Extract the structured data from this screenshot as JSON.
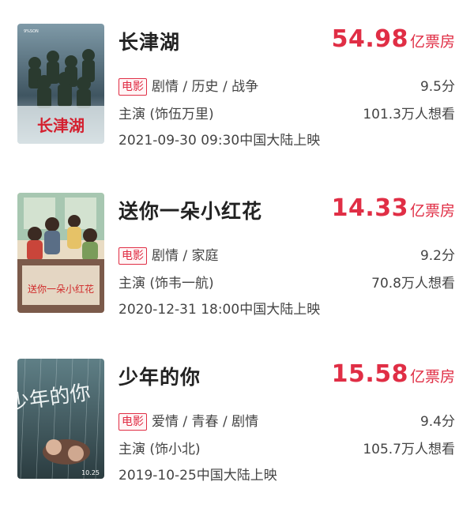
{
  "movies": [
    {
      "title": "长津湖",
      "box_office_amount": "54.98",
      "box_office_unit": "亿票房",
      "tag": "电影",
      "genres": "剧情 / 历史 / 战争",
      "score": "9.5分",
      "cast": "主演 (饰伍万里)",
      "want_to_see": "101.3万人想看",
      "release": "2021-09-30 09:30中国大陆上映",
      "poster_text": "长津湖"
    },
    {
      "title": "送你一朵小红花",
      "box_office_amount": "14.33",
      "box_office_unit": "亿票房",
      "tag": "电影",
      "genres": "剧情 / 家庭",
      "score": "9.2分",
      "cast": "主演 (饰韦一航)",
      "want_to_see": "70.8万人想看",
      "release": "2020-12-31 18:00中国大陆上映",
      "poster_text": "送你一朵小红花"
    },
    {
      "title": "少年的你",
      "box_office_amount": "15.58",
      "box_office_unit": "亿票房",
      "tag": "电影",
      "genres": "爱情 / 青春 / 剧情",
      "score": "9.4分",
      "cast": "主演 (饰小北)",
      "want_to_see": "105.7万人想看",
      "release": "2019-10-25中国大陆上映",
      "poster_text": "少年的你",
      "poster_date": "10.25"
    }
  ],
  "colors": {
    "accent": "#e02e45",
    "title": "#222222",
    "text": "#444444"
  }
}
